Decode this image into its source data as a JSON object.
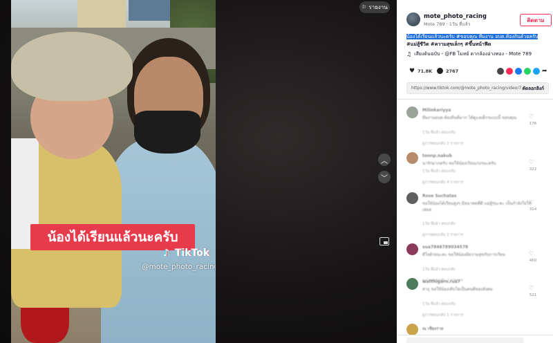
{
  "video": {
    "caption": "น้องได้เรียนแล้วนะครับ",
    "watermark_brand": "TikTok",
    "watermark_handle": "@mote_photo_racing",
    "report_label": "รายงาน",
    "nav_up_icon": "chevron-up-icon",
    "nav_down_icon": "chevron-down-icon"
  },
  "author": {
    "username": "mote_photo_racing",
    "subtitle": "Mote 789 · 1วัน ที่แล้ว",
    "follow_label": "ติดตาม"
  },
  "description": {
    "selected_text": "น้องได้เรียนแล้วนะครับ #ขอบคุณ ทีมงาน อบต.ท้องถิ่นด้วยครับ",
    "tags": "#แม่สู้ชีวิต #ความสุขเล็กๆ #ขึ้นหน้าฟีด"
  },
  "music": {
    "text": "เสียงต้นฉบับ - @FB โมทย์ ตากล้องอ่างทอง - Mote 789"
  },
  "stats": {
    "likes": "71.8K",
    "comments": "2767"
  },
  "link": {
    "url": "https://www.tiktok.com/@mote_photo_racing/video/7210...",
    "copy_label": "คัดลอกลิงก์"
  },
  "comments": [
    {
      "name": "Milinkariyya",
      "text": "ทีมงานอบต.ท้องถิ่นดีมาก ได้ดูแลเด็กๆแบบนี้ ขอบคุณ",
      "meta": "1วัน ที่แล้ว    ตอบกลับ",
      "replies": "ดูการตอบกลับ 2 รายการ",
      "likes": "176",
      "avatar_color": "#9aa39a"
    },
    {
      "name": "tonnp.nakub",
      "text": "น่ารักมากครับ ขอให้น้องเรียนเก่งๆนะครับ",
      "meta": "1วัน ที่แล้ว    ตอบกลับ",
      "replies": "ดูการตอบกลับ 4 รายการ",
      "likes": "322",
      "avatar_color": "#b78c6a"
    },
    {
      "name": "Rose Suchatas",
      "text": "ขอให้น้องได้เรียนสูงๆ มีอนาคตที่ดี แม่สู้ๆนะคะ เป็นกำลังใจให้เสมอ",
      "meta": "1วัน ที่แล้ว    ตอบกลับ",
      "replies": "ดูการตอบกลับ 1 รายการ",
      "likes": "314",
      "avatar_color": "#5f5f5f"
    },
    {
      "name": "sua7846789034578",
      "text": "ดีใจด้วยนะคะ ขอให้น้องมีความสุขกับการเรียน",
      "meta": "1วัน ที่แล้ว    ตอบกลับ",
      "replies": "ดูการตอบกลับ 3 รายการ",
      "likes": "460",
      "avatar_color": "#8a3a5a"
    },
    {
      "name": "watthigarn.rua7",
      "text": "สาธุ ขอให้น้องเติบโตเป็นคนดีของสังคม",
      "meta": "1วัน ที่แล้ว    ตอบกลับ",
      "replies": "ดูการตอบกลับ 1 รายการ",
      "likes": "521",
      "avatar_color": "#4e7a5e"
    },
    {
      "name": "ณ เชียงราย",
      "text": "",
      "meta": "",
      "replies": "",
      "likes": "",
      "avatar_color": "#c9a24a"
    }
  ],
  "share_colors": [
    "#444444",
    "#fe2c55",
    "#1877f2",
    "#25d366",
    "#1da1f2",
    "#333333"
  ]
}
